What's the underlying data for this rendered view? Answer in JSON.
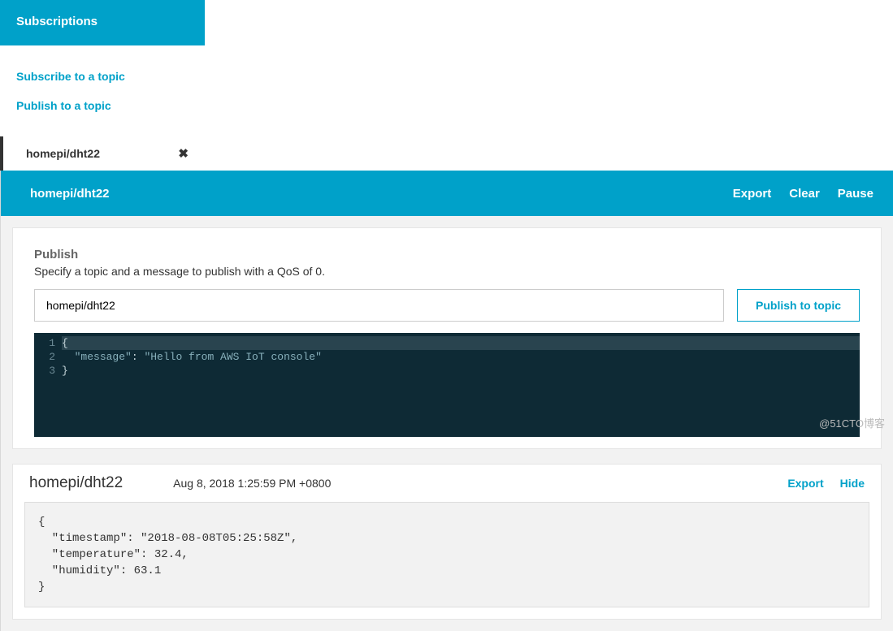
{
  "sidebar": {
    "header": "Subscriptions",
    "subscribe_link": "Subscribe to a topic",
    "publish_link": "Publish to a topic",
    "active_topic": "homepi/dht22"
  },
  "topbar": {
    "title": "homepi/dht22",
    "export": "Export",
    "clear": "Clear",
    "pause": "Pause"
  },
  "publish": {
    "heading": "Publish",
    "instruction": "Specify a topic and a message to publish with a QoS of 0.",
    "topic_value": "homepi/dht22",
    "button": "Publish to topic",
    "editor": {
      "line_numbers": [
        "1",
        "2",
        "3"
      ],
      "l1": "{",
      "l2_key": "\"message\"",
      "l2_val": "\"Hello from AWS IoT console\"",
      "l3": "}"
    }
  },
  "message": {
    "topic": "homepi/dht22",
    "timestamp": "Aug 8, 2018 1:25:59 PM +0800",
    "export": "Export",
    "hide": "Hide",
    "payload": "{\n  \"timestamp\": \"2018-08-08T05:25:58Z\",\n  \"temperature\": 32.4,\n  \"humidity\": 63.1\n}",
    "data": {
      "timestamp": "2018-08-08T05:25:58Z",
      "temperature": 32.4,
      "humidity": 63.1
    }
  },
  "watermark": "@51CTO博客"
}
